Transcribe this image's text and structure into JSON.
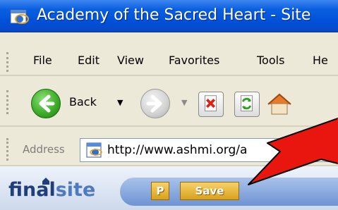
{
  "window": {
    "title": "Academy of the Sacred Heart - Site",
    "icon": "ie-page-icon"
  },
  "menubar": {
    "items": [
      {
        "label": "File"
      },
      {
        "label": "Edit"
      },
      {
        "label": "View"
      },
      {
        "label": "Favorites"
      },
      {
        "label": "Tools"
      },
      {
        "label": "He"
      }
    ]
  },
  "toolbar": {
    "back_label": "Back",
    "buttons": [
      "back-arrow-icon",
      "forward-arrow-icon",
      "stop-icon",
      "refresh-icon",
      "home-icon"
    ]
  },
  "address": {
    "label": "Address",
    "url": "http://www.ashmi.org/a"
  },
  "finalsite": {
    "logo_part1": "fin",
    "logo_part2": "al",
    "logo_part3": "site",
    "p_label": "P",
    "save_label": "Save"
  },
  "annotation": {
    "arrow_color": "#e8160f"
  }
}
